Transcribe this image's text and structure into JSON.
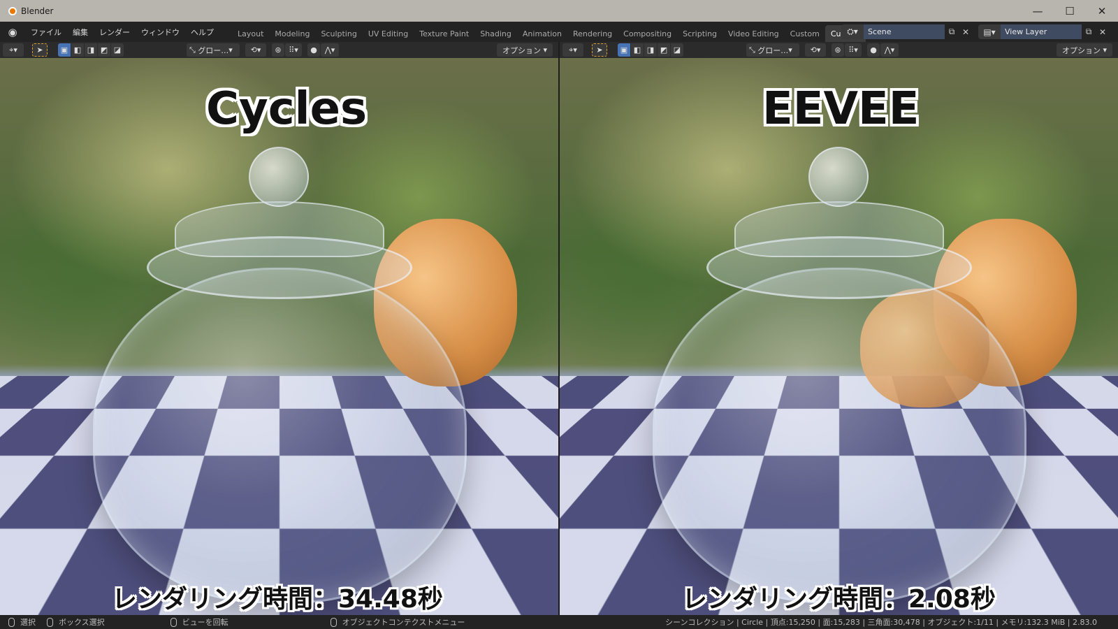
{
  "window": {
    "title": "Blender",
    "minimize": "—",
    "maximize": "☐",
    "close": "✕"
  },
  "menu": [
    "ファイル",
    "編集",
    "レンダー",
    "ウィンドウ",
    "ヘルプ"
  ],
  "tabs": [
    "Layout",
    "Modeling",
    "Sculpting",
    "UV Editing",
    "Texture Paint",
    "Shading",
    "Animation",
    "Rendering",
    "Compositing",
    "Scripting",
    "Video Editing",
    "Custom",
    "Custom"
  ],
  "active_tab_index": 12,
  "scene": {
    "label": "Scene",
    "view_layer": "View Layer"
  },
  "viewport_header": {
    "transform": "グロー…",
    "options": "オプション"
  },
  "left": {
    "engine": "Cycles",
    "render_time": "レンダリング時間：34.48秒"
  },
  "right": {
    "engine": "EEVEE",
    "render_time": "レンダリング時間：2.08秒"
  },
  "status": {
    "select": "選択",
    "box_select": "ボックス選択",
    "rotate_view": "ビューを回転",
    "context_menu": "オブジェクトコンテクストメニュー",
    "stats": "シーンコレクション | Circle | 頂点:15,250 | 面:15,283 | 三角面:30,478 | オブジェクト:1/11 | メモリ:132.3 MiB | 2.83.0"
  }
}
